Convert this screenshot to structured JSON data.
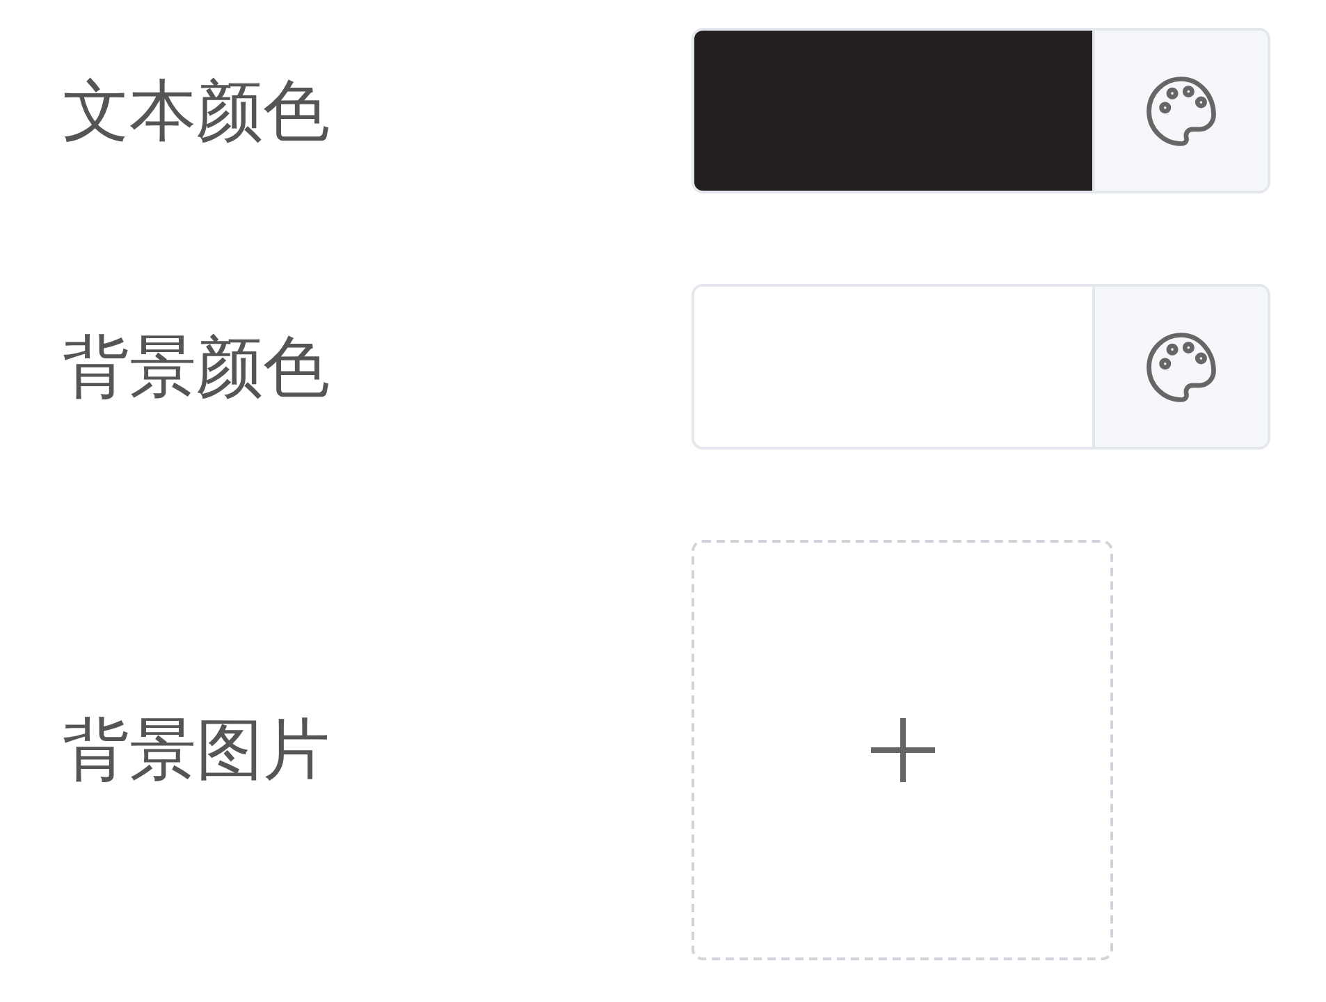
{
  "fields": [
    {
      "label": "文本颜色",
      "kind": "color",
      "color": "#231f20"
    },
    {
      "label": "背景颜色",
      "kind": "color",
      "color": "#ffffff"
    },
    {
      "label": "背景图片",
      "kind": "image"
    }
  ]
}
